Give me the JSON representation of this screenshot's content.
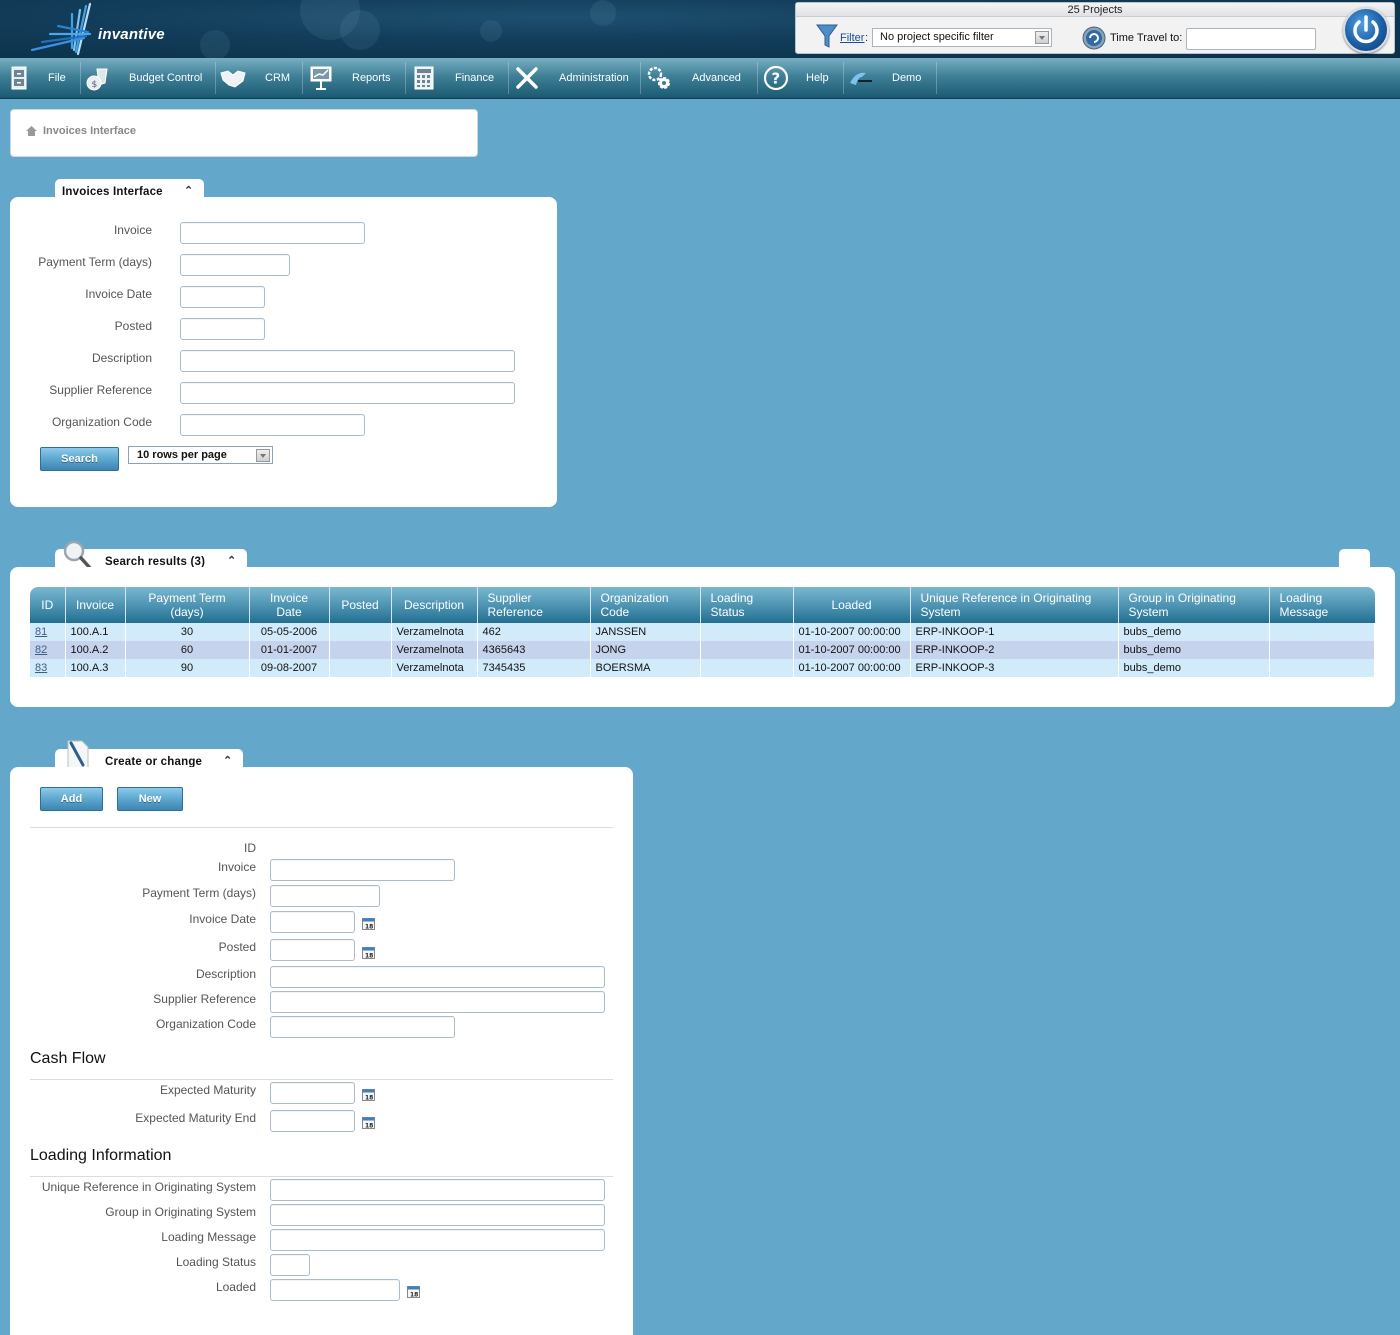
{
  "header": {
    "logo_text": "invantive",
    "project_count": "25 Projects",
    "filter_link": "Filter",
    "filter_colon": ":",
    "filter_value": "No project specific filter",
    "time_travel_label": "Time Travel to:",
    "time_travel_value": ""
  },
  "nav": {
    "items": [
      {
        "label": "File",
        "icon": "file-cabinet-icon"
      },
      {
        "label": "Budget Control",
        "icon": "money-bag-icon"
      },
      {
        "label": "CRM",
        "icon": "handshake-icon"
      },
      {
        "label": "Reports",
        "icon": "presentation-board-icon"
      },
      {
        "label": "Finance",
        "icon": "calculator-icon"
      },
      {
        "label": "Administration",
        "icon": "tools-icon"
      },
      {
        "label": "Advanced",
        "icon": "gears-icon"
      },
      {
        "label": "Help",
        "icon": "question-icon"
      },
      {
        "label": "Demo",
        "icon": "demo-logo-icon"
      }
    ]
  },
  "breadcrumb": {
    "label": "Invoices Interface"
  },
  "search_panel": {
    "tab_title": "Invoices Interface",
    "fields": [
      {
        "label": "Invoice",
        "value": ""
      },
      {
        "label": "Payment Term (days)",
        "value": ""
      },
      {
        "label": "Invoice Date",
        "value": ""
      },
      {
        "label": "Posted",
        "value": ""
      },
      {
        "label": "Description",
        "value": ""
      },
      {
        "label": "Supplier Reference",
        "value": ""
      },
      {
        "label": "Organization Code",
        "value": ""
      }
    ],
    "search_button": "Search",
    "rows_per_page": "10 rows per page"
  },
  "results": {
    "tab_title": "Search results (3)",
    "columns": [
      "ID",
      "Invoice",
      "Payment Term (days)",
      "Invoice Date",
      "Posted",
      "Description",
      "Supplier Reference",
      "Organization Code",
      "Loading Status",
      "Loaded",
      "Unique Reference in Originating System",
      "Group in Originating System",
      "Loading Message"
    ],
    "rows": [
      [
        "81",
        "100.A.1",
        "30",
        "05-05-2006",
        "",
        "Verzamelnota",
        "462",
        "JANSSEN",
        "",
        "01-10-2007 00:00:00",
        "ERP-INKOOP-1",
        "bubs_demo",
        ""
      ],
      [
        "82",
        "100.A.2",
        "60",
        "01-01-2007",
        "",
        "Verzamelnota",
        "4365643",
        "JONG",
        "",
        "01-10-2007 00:00:00",
        "ERP-INKOOP-2",
        "bubs_demo",
        ""
      ],
      [
        "83",
        "100.A.3",
        "90",
        "09-08-2007",
        "",
        "Verzamelnota",
        "7345435",
        "BOERSMA",
        "",
        "01-10-2007 00:00:00",
        "ERP-INKOOP-3",
        "bubs_demo",
        ""
      ]
    ]
  },
  "edit_panel": {
    "tab_title": "Create or change",
    "add_button": "Add",
    "new_button": "New",
    "id_label": "ID",
    "id_value": "",
    "fields": [
      {
        "label": "Invoice",
        "value": ""
      },
      {
        "label": "Payment Term (days)",
        "value": ""
      },
      {
        "label": "Invoice Date",
        "value": ""
      },
      {
        "label": "Posted",
        "value": ""
      },
      {
        "label": "Description",
        "value": ""
      },
      {
        "label": "Supplier Reference",
        "value": ""
      },
      {
        "label": "Organization Code",
        "value": ""
      }
    ],
    "cash_flow": {
      "title": "Cash Flow",
      "fields": [
        {
          "label": "Expected Maturity",
          "value": ""
        },
        {
          "label": "Expected Maturity End",
          "value": ""
        }
      ]
    },
    "loading": {
      "title": "Loading Information",
      "fields": [
        {
          "label": "Unique Reference in Originating System",
          "value": ""
        },
        {
          "label": "Group in Originating System",
          "value": ""
        },
        {
          "label": "Loading Message",
          "value": ""
        },
        {
          "label": "Loading Status",
          "value": ""
        },
        {
          "label": "Loaded",
          "value": ""
        }
      ]
    }
  },
  "colors": {
    "background": "#63a8cb",
    "header_dark": "#0b2f47",
    "nav_top": "#78aec2",
    "nav_bottom": "#1b5a72",
    "table_row_odd": "#d1ebfb",
    "table_row_even": "#c6d3ec",
    "button_blue": "#5da6cf"
  }
}
